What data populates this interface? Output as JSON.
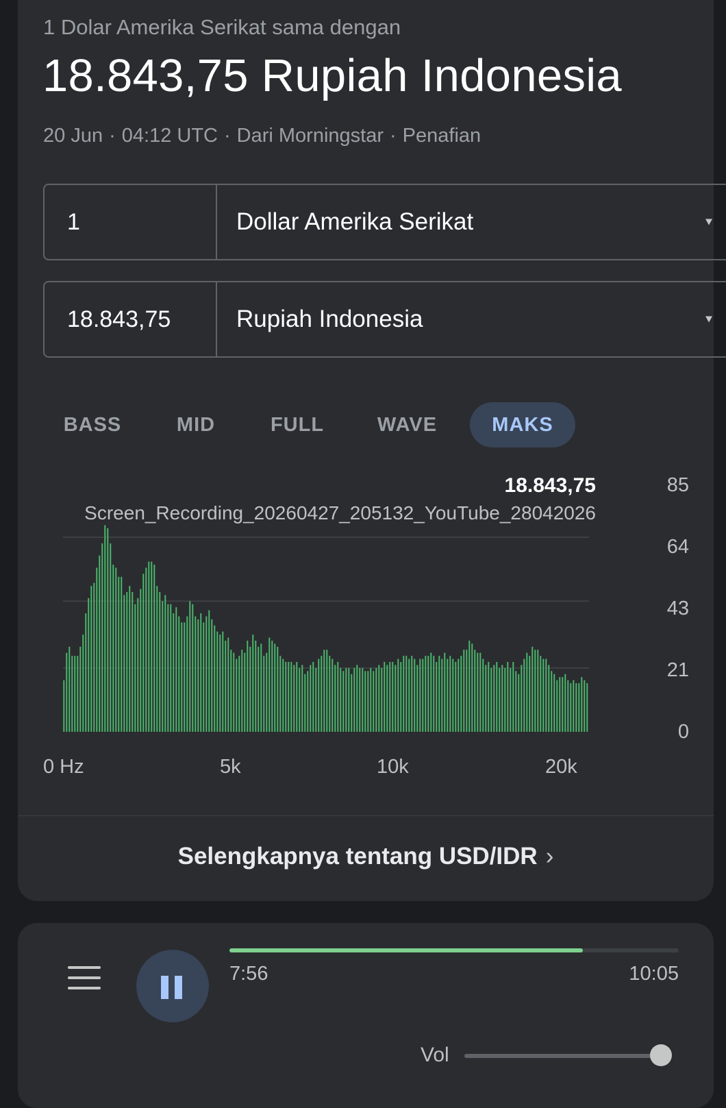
{
  "header": {
    "subtitle": "1 Dolar Amerika Serikat sama dengan",
    "title": "18.843,75 Rupiah Indonesia",
    "date": "20 Jun",
    "time": "04:12 UTC",
    "source": "Dari Morningstar",
    "disclaimer": "Penafian",
    "separator": "·"
  },
  "converter": {
    "from_amount": "1",
    "from_currency": "Dollar Amerika Serikat",
    "to_amount": "18.843,75",
    "to_currency": "Rupiah Indonesia"
  },
  "tabs": [
    {
      "label": "BASS",
      "active": false
    },
    {
      "label": "MID",
      "active": false
    },
    {
      "label": "FULL",
      "active": false
    },
    {
      "label": "WAVE",
      "active": false
    },
    {
      "label": "MAKS",
      "active": true
    }
  ],
  "readout": {
    "value": "18.843,75",
    "track_name": "Screen_Recording_20260427_205132_YouTube_28042026"
  },
  "chart_data": {
    "type": "bar",
    "ylim": [
      0,
      85
    ],
    "yticks": [
      "85",
      "64",
      "43",
      "21",
      "0"
    ],
    "xticks": [
      {
        "label": "0 Hz",
        "value": 0
      },
      {
        "label": "5k",
        "value": 5000
      },
      {
        "label": "10k",
        "value": 10000
      },
      {
        "label": "20k",
        "value": 20000
      }
    ],
    "grid": true,
    "color_start": "#2e7d3e",
    "color_end": "#5fd38a",
    "values": [
      17,
      26,
      28,
      25,
      25,
      25,
      28,
      32,
      39,
      44,
      48,
      49,
      54,
      58,
      62,
      68,
      67,
      62,
      55,
      54,
      51,
      51,
      45,
      46,
      48,
      46,
      42,
      44,
      47,
      52,
      54,
      56,
      56,
      55,
      48,
      46,
      43,
      45,
      42,
      42,
      39,
      41,
      38,
      36,
      36,
      38,
      43,
      42,
      38,
      37,
      39,
      36,
      38,
      40,
      37,
      35,
      33,
      32,
      33,
      30,
      31,
      27,
      26,
      24,
      25,
      27,
      26,
      30,
      28,
      32,
      30,
      28,
      29,
      25,
      26,
      31,
      30,
      29,
      28,
      25,
      24,
      23,
      23,
      23,
      22,
      23,
      21,
      22,
      19,
      20,
      22,
      23,
      21,
      24,
      25,
      27,
      27,
      25,
      24,
      22,
      23,
      21,
      20,
      21,
      21,
      19,
      21,
      22,
      21,
      21,
      20,
      20,
      21,
      20,
      21,
      22,
      21,
      23,
      22,
      23,
      23,
      22,
      24,
      23,
      25,
      25,
      24,
      25,
      24,
      22,
      24,
      24,
      25,
      25,
      26,
      25,
      23,
      25,
      24,
      26,
      24,
      25,
      24,
      23,
      24,
      25,
      27,
      27,
      30,
      29,
      27,
      26,
      26,
      24,
      22,
      23,
      21,
      22,
      23,
      21,
      22,
      21,
      23,
      21,
      23,
      20,
      19,
      22,
      24,
      26,
      25,
      28,
      27,
      27,
      25,
      24,
      24,
      22,
      20,
      19,
      17,
      18,
      18,
      19,
      17,
      16,
      17,
      16,
      16,
      18,
      17,
      16
    ]
  },
  "more_link": {
    "label": "Selengkapnya tentang USD/IDR",
    "chevron": "›"
  },
  "player": {
    "menu_icon": "menu-icon",
    "play_state": "paused-icon",
    "current_time": "7:56",
    "total_time": "10:05",
    "progress": 0.787,
    "volume_label": "Vol",
    "volume": 0.97,
    "accent": "#7fd18f"
  }
}
